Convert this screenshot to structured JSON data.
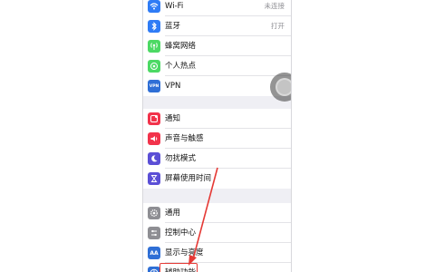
{
  "group1": [
    {
      "label": "Wi-Fi",
      "value": "未连接",
      "icon": "wifi-icon",
      "color": "#2f7cf6"
    },
    {
      "label": "蓝牙",
      "value": "打开",
      "icon": "bluetooth-icon",
      "color": "#2f7cf6"
    },
    {
      "label": "蜂窝网络",
      "value": "",
      "icon": "cellular-icon",
      "color": "#4cd964"
    },
    {
      "label": "个人热点",
      "value": "",
      "icon": "hotspot-icon",
      "color": "#4cd964"
    },
    {
      "label": "VPN",
      "value": "",
      "icon": "vpn-icon",
      "color": "#2f6fd6",
      "icon_text": "VPN"
    }
  ],
  "group2": [
    {
      "label": "通知",
      "icon": "notifications-icon",
      "color": "#f2334b"
    },
    {
      "label": "声音与触感",
      "icon": "sounds-icon",
      "color": "#f2334b"
    },
    {
      "label": "勿扰模式",
      "icon": "moon-icon",
      "color": "#5b4fd6"
    },
    {
      "label": "屏幕使用时间",
      "icon": "hourglass-icon",
      "color": "#5b4fd6"
    }
  ],
  "group3": [
    {
      "label": "通用",
      "icon": "gear-icon",
      "color": "#8e8e93"
    },
    {
      "label": "控制中心",
      "icon": "control-center-icon",
      "color": "#8e8e93"
    },
    {
      "label": "显示与亮度",
      "icon": "display-icon",
      "color": "#2f6fd6",
      "icon_text": "AA"
    },
    {
      "label": "辅助功能",
      "icon": "accessibility-icon",
      "color": "#2f6fd6"
    }
  ],
  "colors": {
    "annotation": "#e53935",
    "background": "#efeff4"
  }
}
